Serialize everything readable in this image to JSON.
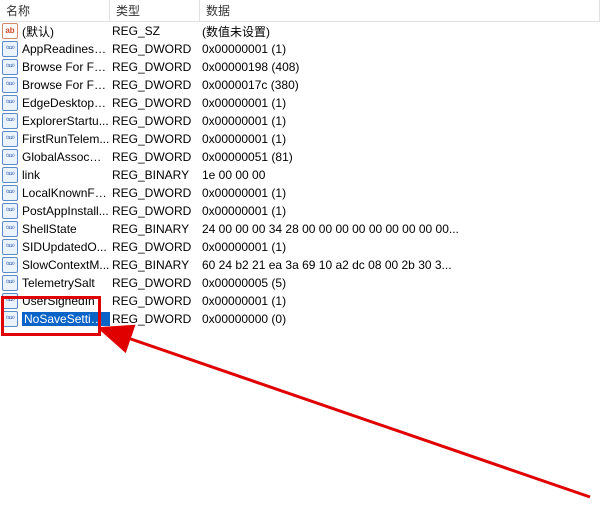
{
  "columns": {
    "name": "名称",
    "type": "类型",
    "data": "数据"
  },
  "rows": [
    {
      "icon": "sz",
      "name": "(默认)",
      "type": "REG_SZ",
      "data": "(数值未设置)"
    },
    {
      "icon": "dw",
      "name": "AppReadiness...",
      "type": "REG_DWORD",
      "data": "0x00000001 (1)"
    },
    {
      "icon": "dw",
      "name": "Browse For Fol...",
      "type": "REG_DWORD",
      "data": "0x00000198 (408)"
    },
    {
      "icon": "dw",
      "name": "Browse For Fol...",
      "type": "REG_DWORD",
      "data": "0x0000017c (380)"
    },
    {
      "icon": "dw",
      "name": "EdgeDesktopS...",
      "type": "REG_DWORD",
      "data": "0x00000001 (1)"
    },
    {
      "icon": "dw",
      "name": "ExplorerStartu...",
      "type": "REG_DWORD",
      "data": "0x00000001 (1)"
    },
    {
      "icon": "dw",
      "name": "FirstRunTelem...",
      "type": "REG_DWORD",
      "data": "0x00000001 (1)"
    },
    {
      "icon": "dw",
      "name": "GlobalAssocCh...",
      "type": "REG_DWORD",
      "data": "0x00000051 (81)"
    },
    {
      "icon": "dw",
      "name": "link",
      "type": "REG_BINARY",
      "data": "1e 00 00 00"
    },
    {
      "icon": "dw",
      "name": "LocalKnownFol...",
      "type": "REG_DWORD",
      "data": "0x00000001 (1)"
    },
    {
      "icon": "dw",
      "name": "PostAppInstall...",
      "type": "REG_DWORD",
      "data": "0x00000001 (1)"
    },
    {
      "icon": "dw",
      "name": "ShellState",
      "type": "REG_BINARY",
      "data": "24 00 00 00 34 28 00 00 00 00 00 00 00 00 00..."
    },
    {
      "icon": "dw",
      "name": "SIDUpdatedO...",
      "type": "REG_DWORD",
      "data": "0x00000001 (1)"
    },
    {
      "icon": "dw",
      "name": "SlowContextM...",
      "type": "REG_BINARY",
      "data": "60 24 b2 21 ea 3a 69 10 a2 dc 08 00 2b 30 3..."
    },
    {
      "icon": "dw",
      "name": "TelemetrySalt",
      "type": "REG_DWORD",
      "data": "0x00000005 (5)"
    },
    {
      "icon": "dw",
      "name": "UserSignedIn",
      "type": "REG_DWORD",
      "data": "0x00000001 (1)"
    },
    {
      "icon": "dw",
      "name": "NoSaveSettings",
      "type": "REG_DWORD",
      "data": "0x00000000 (0)",
      "selected": true
    }
  ]
}
